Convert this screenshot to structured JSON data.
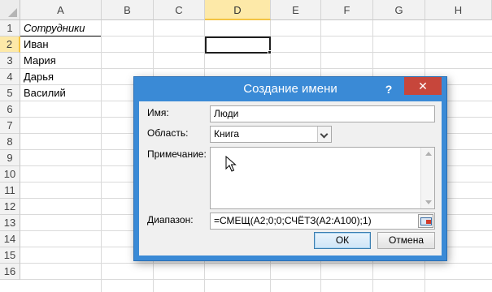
{
  "sheet": {
    "columns": [
      "A",
      "B",
      "C",
      "D",
      "E",
      "F",
      "G",
      "H"
    ],
    "rows": [
      "1",
      "2",
      "3",
      "4",
      "5",
      "6",
      "7",
      "8",
      "9",
      "10",
      "11",
      "12",
      "13",
      "14",
      "15",
      "16"
    ],
    "cells": {
      "a1": "Сотрудники",
      "a2": "Иван",
      "a3": "Мария",
      "a4": "Дарья",
      "a5": "Василий"
    }
  },
  "dialog": {
    "title": "Создание имени",
    "help": "?",
    "close": "✕",
    "name_label": "Имя:",
    "name_value": "Люди",
    "scope_label": "Область:",
    "scope_value": "Книга",
    "comment_label": "Примечание:",
    "comment_value": "",
    "range_label": "Диапазон:",
    "range_value": "=СМЕЩ(A2;0;0;СЧЁТЗ(A2:A100);1)",
    "ok_label": "ОК",
    "cancel_label": "Отмена"
  },
  "colors": {
    "title_bar": "#3a8ad6",
    "close_button": "#c7463b",
    "active_header": "#fde9a8"
  },
  "icons": {
    "range_selector": "collapse-dialog-icon",
    "pointer": "mouse-cursor-icon"
  }
}
